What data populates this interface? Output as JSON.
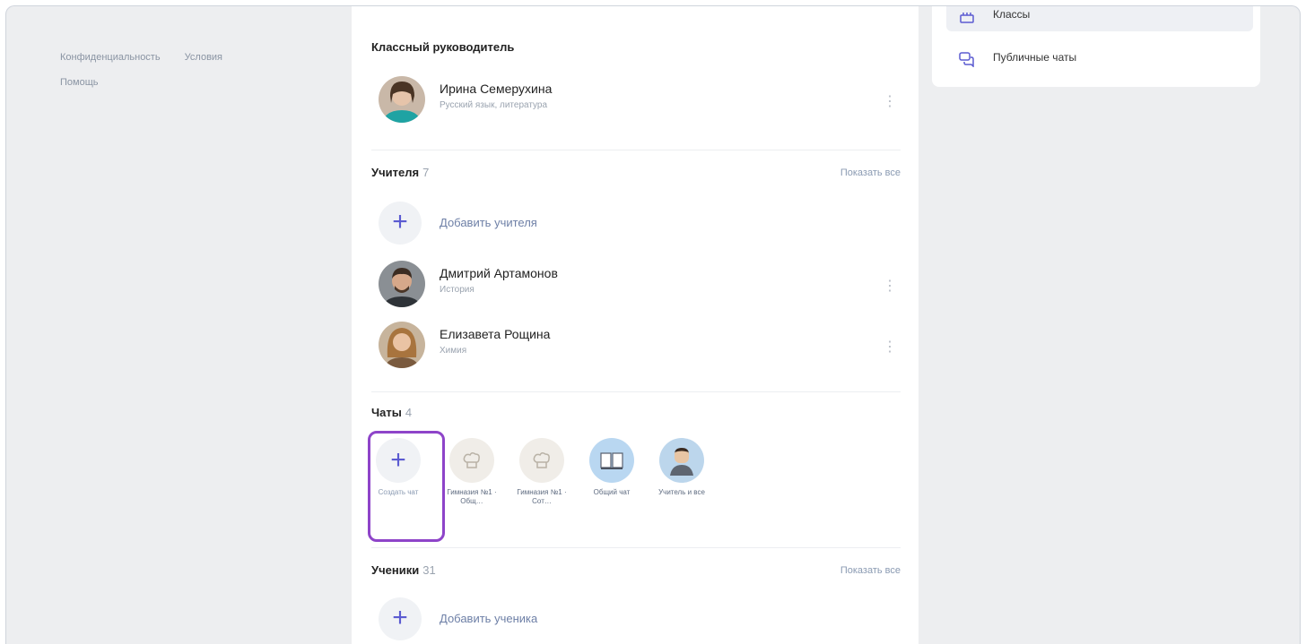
{
  "footer": {
    "privacy": "Конфиденциальность",
    "terms": "Условия",
    "help": "Помощь"
  },
  "class_teacher": {
    "title": "Классный руководитель",
    "name": "Ирина Семерухина",
    "subject": "Русский язык, литература"
  },
  "teachers": {
    "title": "Учителя",
    "count": "7",
    "show_all": "Показать все",
    "add_label": "Добавить учителя",
    "items": [
      {
        "name": "Дмитрий Артамонов",
        "subject": "История"
      },
      {
        "name": "Елизавета Рощина",
        "subject": "Химия"
      }
    ]
  },
  "chats": {
    "title": "Чаты",
    "count": "4",
    "create_label": "Создать чат",
    "items": [
      {
        "label": "Гимназия №1 · Общ…",
        "icon": "chef-hat-icon"
      },
      {
        "label": "Гимназия №1 · Сот…",
        "icon": "chef-hat-icon"
      },
      {
        "label": "Общий чат",
        "icon": "book-icon"
      },
      {
        "label": "Учитель и все",
        "icon": "avatar-icon"
      }
    ]
  },
  "students": {
    "title": "Ученики",
    "count": "31",
    "show_all": "Показать все",
    "add_label": "Добавить ученика"
  },
  "right_menu": {
    "items": [
      {
        "label": "Классы",
        "icon": "classes-icon"
      },
      {
        "label": "Публичные чаты",
        "icon": "chat-bubbles-icon"
      }
    ]
  },
  "colors": {
    "accent": "#5b5bd1",
    "highlight": "#8e44c9",
    "background": "#edeef0"
  }
}
